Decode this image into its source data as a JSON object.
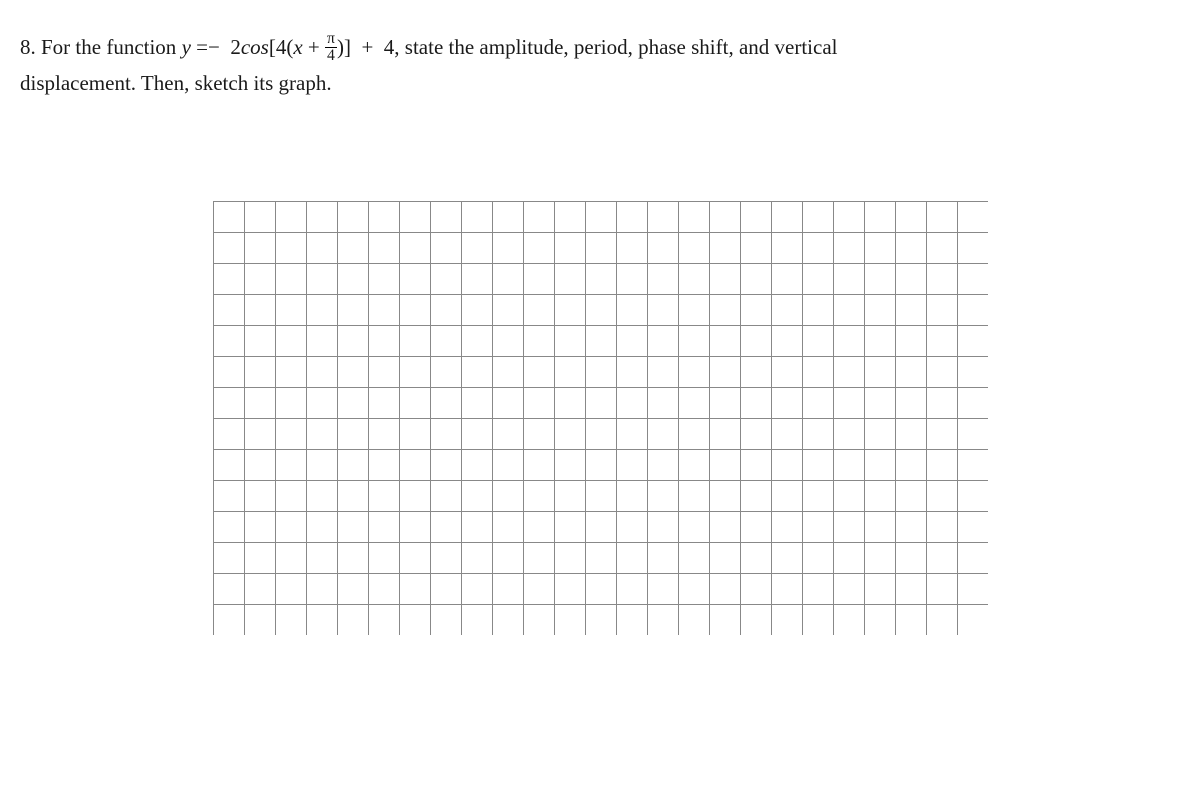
{
  "question": {
    "number": "8.",
    "prefix": "For the function",
    "varY": "y",
    "equals": "=−",
    "coef": "2",
    "func": "cos",
    "bracket_open": "[4(",
    "varX": "x",
    "plus": "+",
    "frac_num": "π",
    "frac_den": "4",
    "bracket_close": ")]",
    "plus2": "+",
    "const": "4,",
    "suffix1": "state the amplitude, period, phase shift, and vertical",
    "suffix2": "displacement. Then, sketch its graph."
  },
  "grid": {
    "cols": 25,
    "rows": 14,
    "cell": 31
  }
}
